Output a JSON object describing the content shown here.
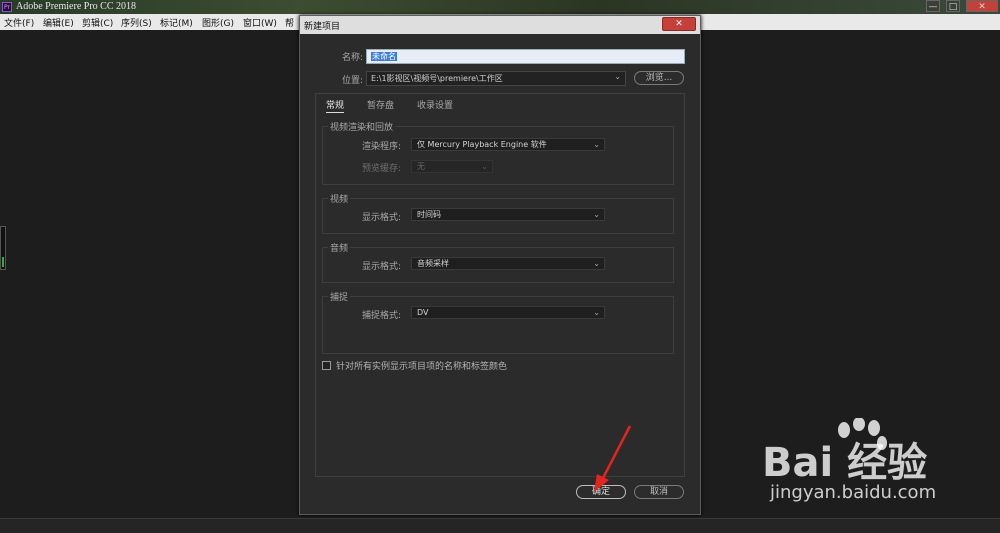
{
  "app": {
    "title": "Adobe Premiere Pro CC 2018",
    "logo_text": "Pr",
    "controls": [
      "—",
      "□",
      "✕"
    ],
    "menu": [
      "文件(F)",
      "编辑(E)",
      "剪辑(C)",
      "序列(S)",
      "标记(M)",
      "图形(G)",
      "窗口(W)",
      "帮"
    ]
  },
  "dialog": {
    "title": "新建项目",
    "close_icon": "✕",
    "name_label": "名称:",
    "name_value": "未命名",
    "location_label": "位置:",
    "location_value": "E:\\1影视区\\视频号\\premiere\\工作区",
    "browse_button": "浏览...",
    "tabs": [
      "常规",
      "暂存盘",
      "收录设置"
    ],
    "groups": {
      "render": {
        "title": "视频渲染和回放",
        "renderer_label": "渲染程序:",
        "renderer_value": "仅 Mercury Playback Engine 软件",
        "preview_cache_label": "预览缓存:",
        "preview_cache_value": "无"
      },
      "video": {
        "title": "视频",
        "display_label": "显示格式:",
        "display_value": "时间码"
      },
      "audio": {
        "title": "音频",
        "display_label": "显示格式:",
        "display_value": "音频采样"
      },
      "capture": {
        "title": "捕捉",
        "format_label": "捕捉格式:",
        "format_value": "DV"
      }
    },
    "checkbox_label": "针对所有实例显示项目项的名称和标签颜色",
    "checkbox_checked": false,
    "ok_button": "确定",
    "cancel_button": "取消"
  },
  "watermark": {
    "main": "Bai 经验",
    "url": "jingyan.baidu.com"
  },
  "colors": {
    "arrow": "#e0261e",
    "selection": "#3d7fd6",
    "close": "#c6403a"
  }
}
